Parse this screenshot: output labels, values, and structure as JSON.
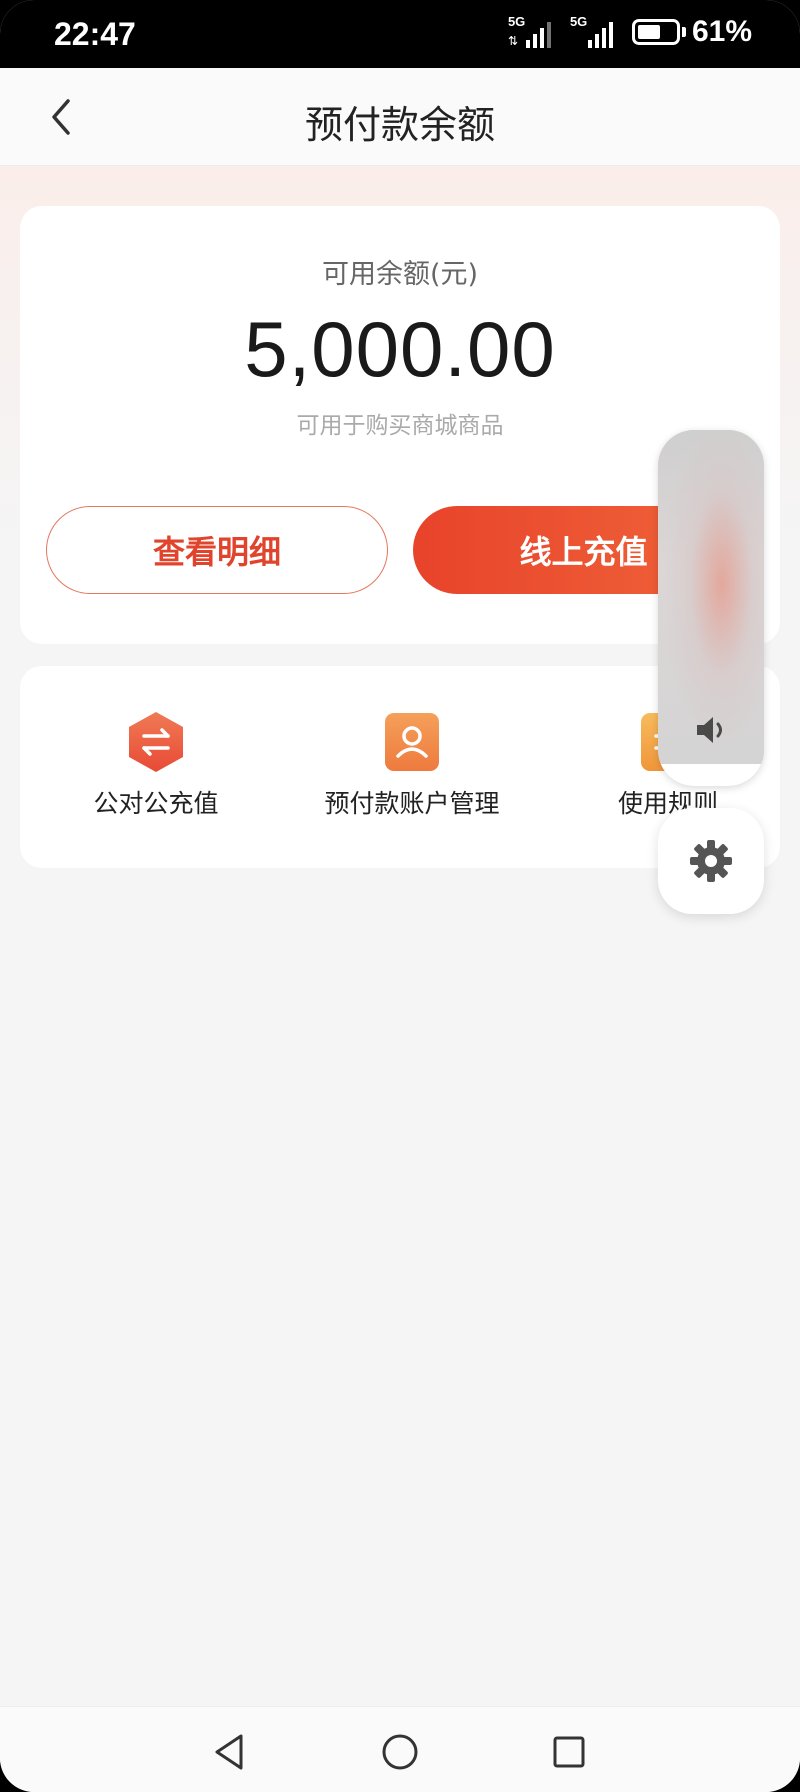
{
  "status_bar": {
    "time": "22:47",
    "signal1": "5G",
    "signal2": "5G",
    "battery_percent": "61%",
    "battery_level": 0.61
  },
  "header": {
    "title": "预付款余额",
    "back_icon": "chevron-left-icon"
  },
  "balance": {
    "label": "可用余额(元)",
    "amount": "5,000.00",
    "subtitle": "可用于购买商城商品",
    "detail_button": "查看明细",
    "recharge_button": "线上充值"
  },
  "shortcuts": [
    {
      "label": "公对公充值",
      "icon": "exchange-hexagon-icon",
      "color": "#ee5a3f"
    },
    {
      "label": "预付款账户管理",
      "icon": "user-account-icon",
      "color": "#f0843e"
    },
    {
      "label": "使用规则",
      "icon": "rules-document-icon",
      "color": "#f2a43c"
    }
  ],
  "overlay": {
    "volume_icon": "speaker-icon",
    "settings_icon": "gear-icon"
  },
  "nav_bar": {
    "back_icon": "triangle-back-icon",
    "home_icon": "circle-home-icon",
    "recents_icon": "square-recents-icon"
  },
  "colors": {
    "accent": "#e8432b",
    "accent_light": "#f0663a",
    "page_bg": "#f5f5f5"
  }
}
